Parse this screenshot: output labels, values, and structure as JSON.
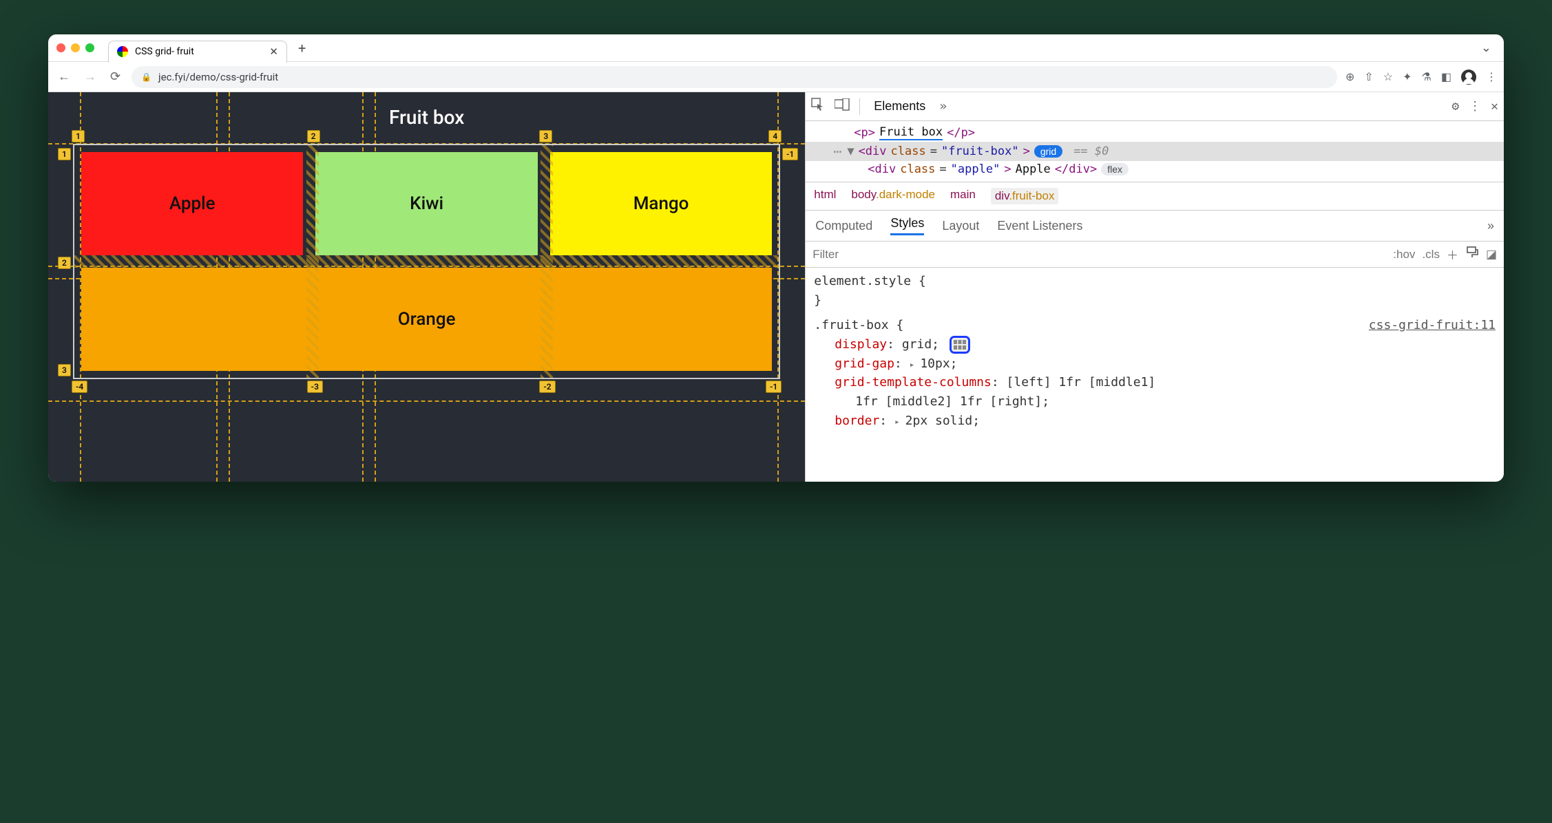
{
  "browser": {
    "tab_title": "CSS grid- fruit",
    "url": "jec.fyi/demo/css-grid-fruit"
  },
  "page": {
    "heading": "Fruit box",
    "cells": {
      "apple": "Apple",
      "kiwi": "Kiwi",
      "mango": "Mango",
      "orange": "Orange"
    },
    "grid_labels": {
      "col_top": [
        "1",
        "2",
        "3",
        "4"
      ],
      "row_left": [
        "1",
        "2",
        "3"
      ],
      "row_right_neg1": "-1",
      "col_bottom_neg": [
        "-4",
        "-3",
        "-2",
        "-1"
      ]
    }
  },
  "devtools": {
    "panel": "Elements",
    "dom": {
      "line1_text": "Fruit box",
      "line2_class": "fruit-box",
      "line2_badge": "grid",
      "line2_suffix": "== $0",
      "line3_class": "apple",
      "line3_text": "Apple",
      "line3_badge": "flex"
    },
    "breadcrumbs": [
      "html",
      "body.dark-mode",
      "main",
      "div.fruit-box"
    ],
    "subtabs": [
      "Computed",
      "Styles",
      "Layout",
      "Event Listeners"
    ],
    "active_subtab": "Styles",
    "filter_placeholder": "Filter",
    "toolbar_labels": {
      "hov": ":hov",
      "cls": ".cls"
    },
    "styles": {
      "element_style_header": "element.style {",
      "element_style_close": "}",
      "rule_selector": ".fruit-box {",
      "rule_source": "css-grid-fruit:11",
      "props": {
        "display": {
          "name": "display",
          "value": "grid"
        },
        "grid_gap": {
          "name": "grid-gap",
          "value": "10px"
        },
        "grid_template_columns": {
          "name": "grid-template-columns",
          "value_line1": "[left] 1fr [middle1]",
          "value_line2": "1fr [middle2] 1fr [right];"
        },
        "border": {
          "name": "border",
          "value": "2px solid"
        }
      }
    }
  }
}
